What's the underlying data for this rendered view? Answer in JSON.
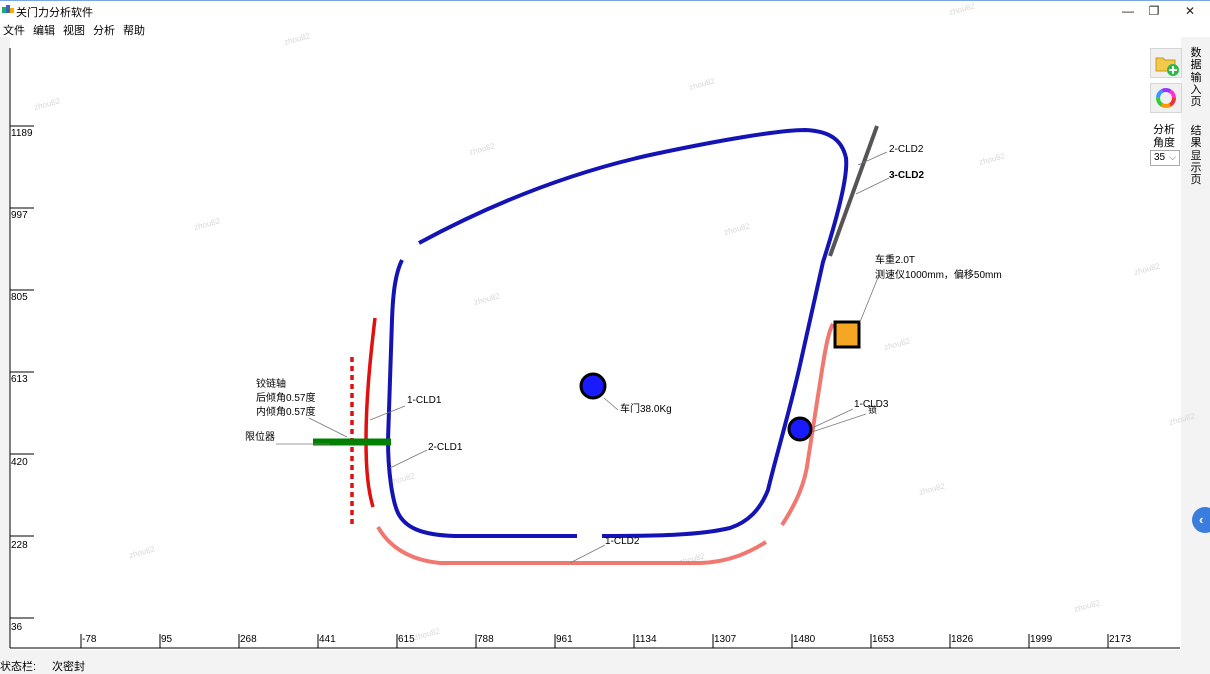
{
  "window": {
    "title": "关门力分析软件",
    "minimize": "—",
    "restore": "❐",
    "close": "✕"
  },
  "menu": [
    "文件",
    "编辑",
    "视图",
    "分析",
    "帮助"
  ],
  "axes": {
    "y_ticks": [
      "1189",
      "997",
      "805",
      "613",
      "420",
      "228",
      "36"
    ],
    "x_ticks": [
      "-78",
      "95",
      "268",
      "441",
      "615",
      "788",
      "961",
      "1134",
      "1307",
      "1480",
      "1653",
      "1826",
      "1999",
      "2173"
    ]
  },
  "labels": {
    "hinge_axis": "铰链轴",
    "rear_tilt": "后倾角0.57度",
    "inner_tilt": "内倾角0.57度",
    "limiter": "限位器",
    "cld1_1": "1-CLD1",
    "cld1_2": "2-CLD1",
    "cld2_1": "1-CLD2",
    "cld2_2": "2-CLD2",
    "cld2_3": "3-CLD2",
    "cld3_1": "1-CLD3",
    "lock": "锁",
    "door": "车门38.0Kg",
    "vehicle_weight": "车重2.0T",
    "speed_meter": "测速仪1000mm，偏移50mm"
  },
  "watermark": "zhou82",
  "side_panel": {
    "data_input_icon": "folder-add-icon",
    "color_wheel_icon": "color-wheel-icon",
    "angle_label_1": "分析",
    "angle_label_2": "角度",
    "angle_value": "35",
    "tab_data_input": [
      "数",
      "据",
      "输",
      "入",
      "页"
    ],
    "tab_result": [
      "结",
      "果",
      "显",
      "示",
      "页"
    ]
  },
  "status": {
    "label": "状态栏:",
    "value": "次密封"
  },
  "colors": {
    "door_seal": "#1414b4",
    "body_seal": "#f07870",
    "red_seal": "#e01010",
    "limiter": "#008000",
    "gray_seal": "#555555",
    "meter": "#f5a623",
    "accent": "#3b7ddd"
  }
}
